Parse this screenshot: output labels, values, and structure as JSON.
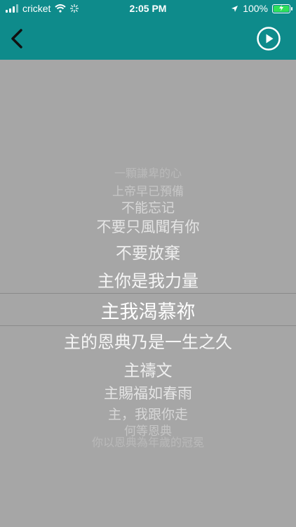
{
  "status": {
    "carrier": "cricket",
    "time": "2:05 PM",
    "battery": "100%",
    "icons": [
      "signal-icon",
      "wifi-icon",
      "activity-icon",
      "location-icon",
      "battery-icon",
      "charging-icon"
    ]
  },
  "nav": {
    "back_icon": "back-chevron-icon",
    "play_icon": "play-circle-icon"
  },
  "lyrics": {
    "lines": [
      "一顆謙卑的心",
      "上帝早已預備",
      "不能忘记",
      "不要只風聞有你",
      "不要放棄",
      "主你是我力量",
      "主我渴慕祢",
      "主的恩典乃是一生之久",
      "主禱文",
      "主賜福如春雨",
      "主，我跟你走",
      "何等恩典",
      "你以恩典為年歲的冠冕"
    ],
    "selected_index": 6
  },
  "colors": {
    "header": "#0e8b8b",
    "background": "#a6a6a6",
    "text": "#ffffff"
  }
}
